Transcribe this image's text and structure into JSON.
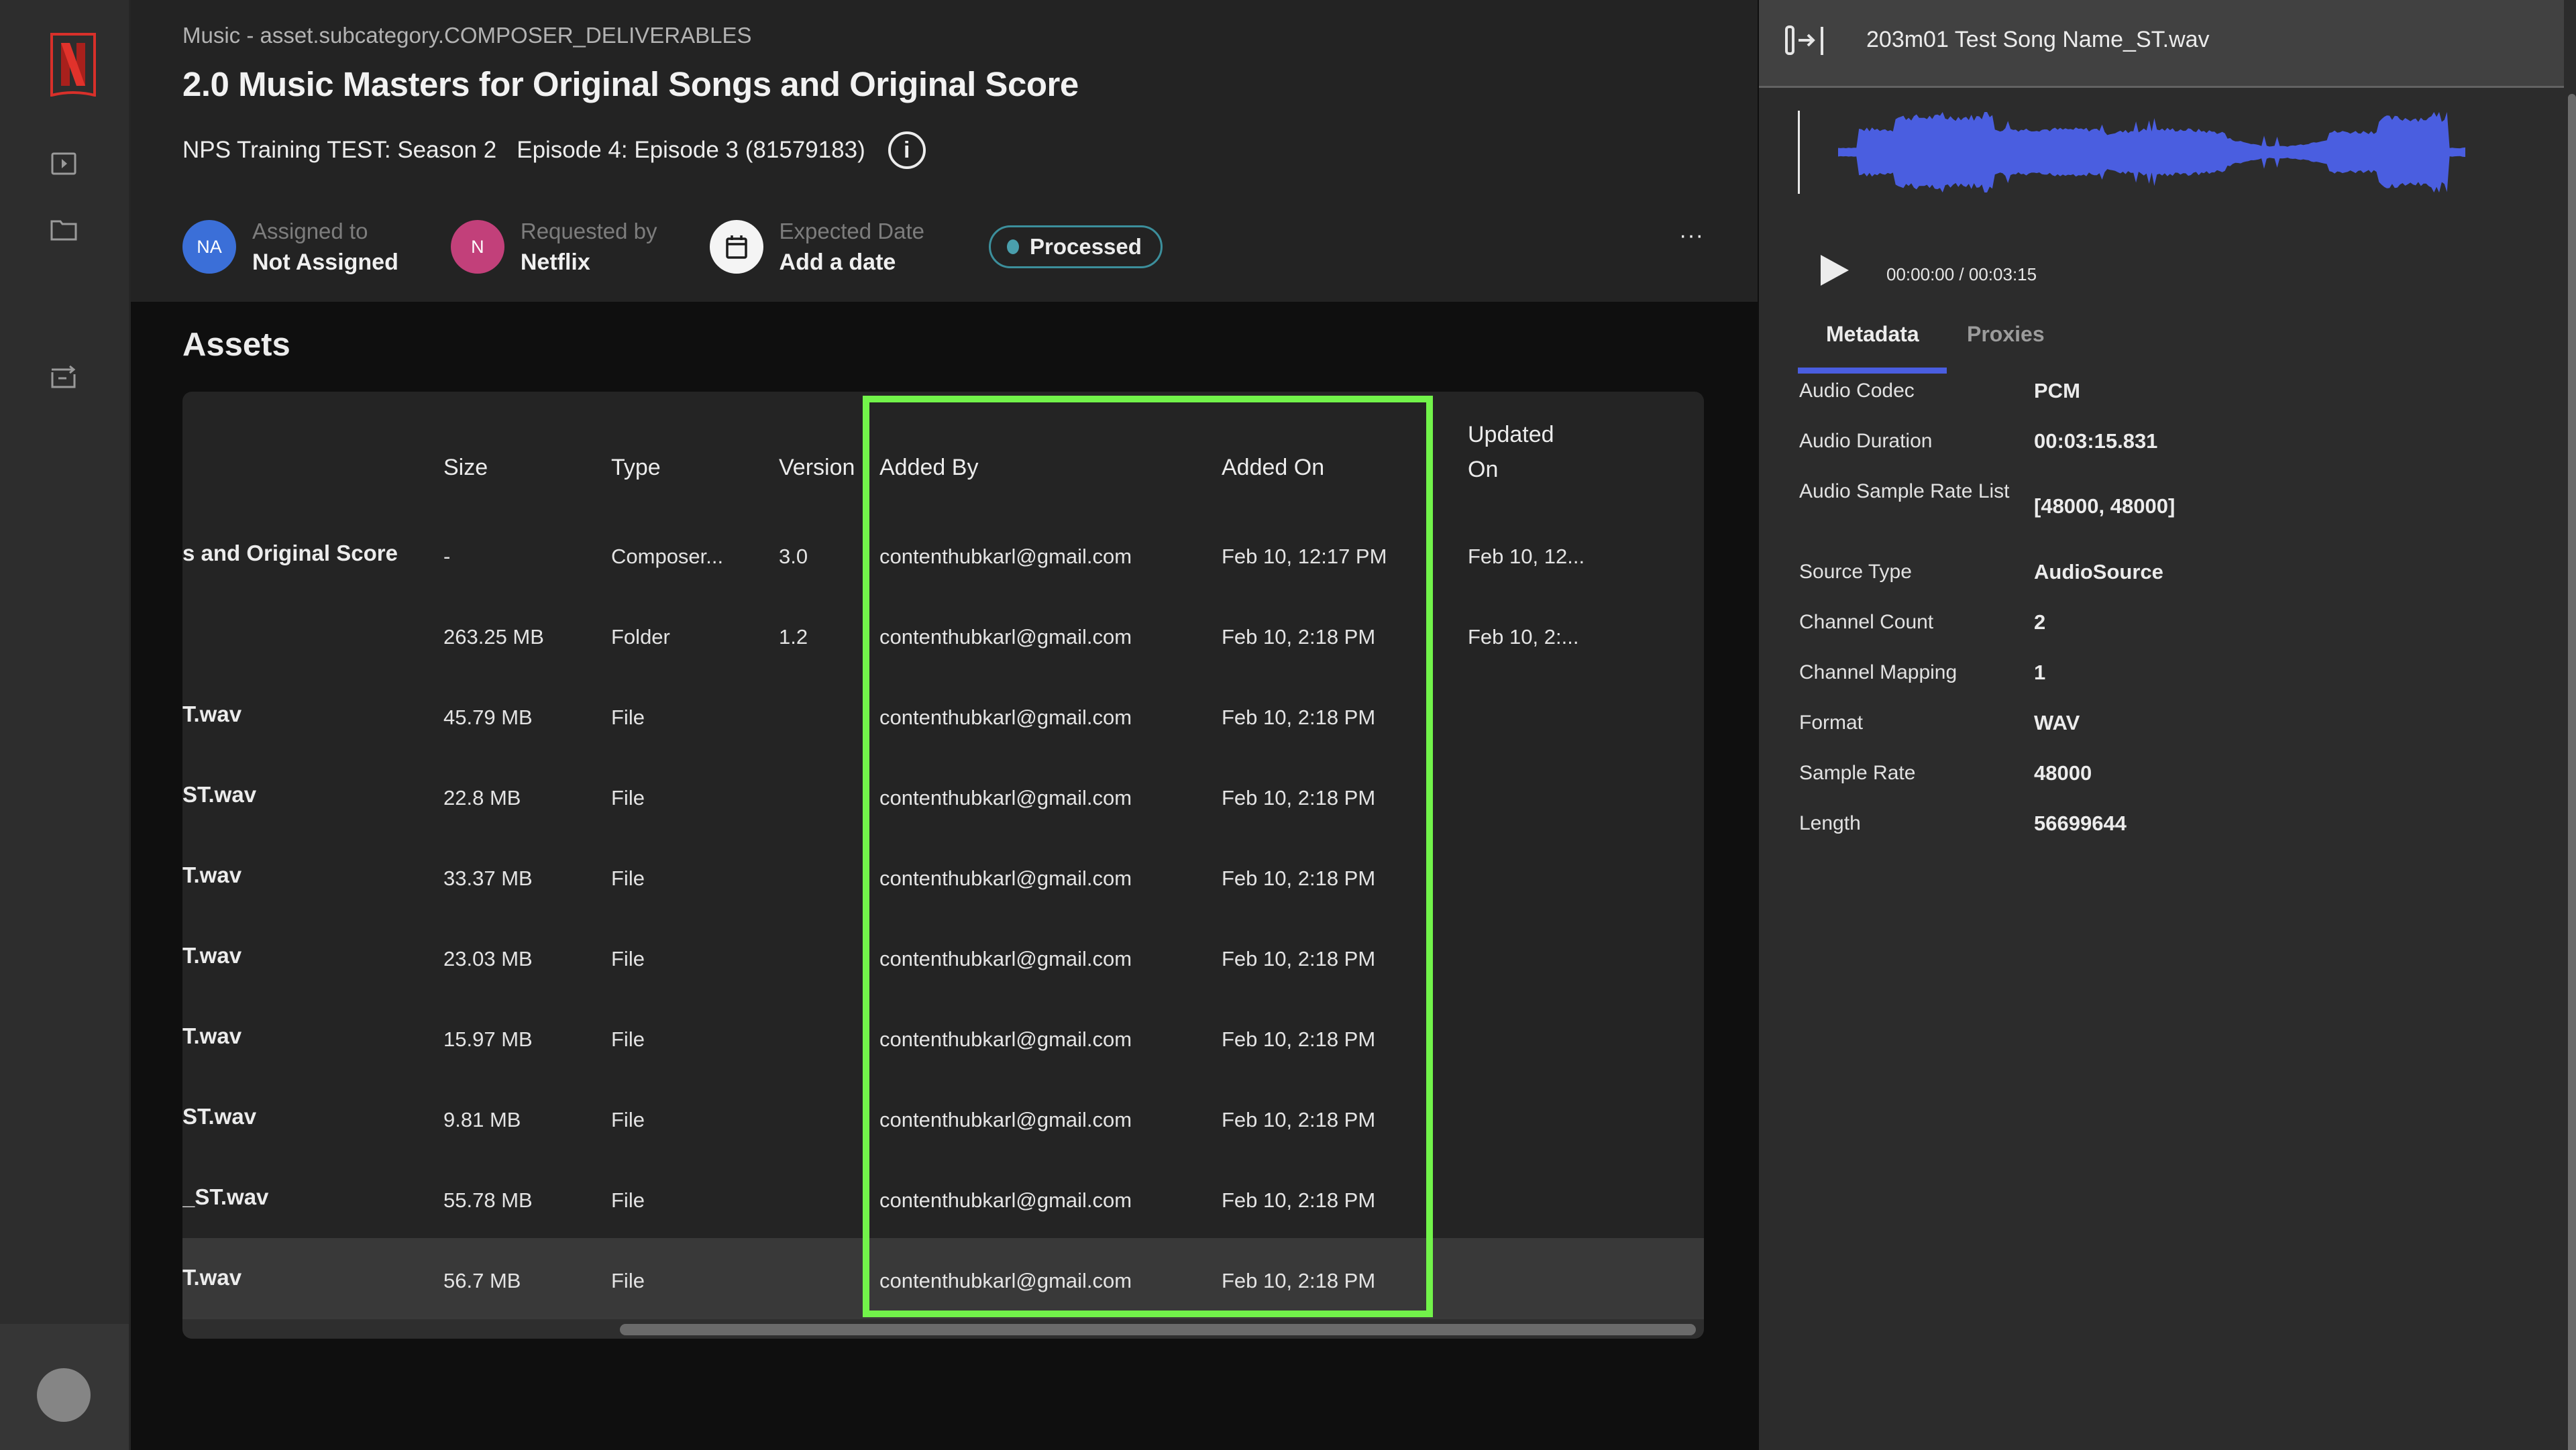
{
  "rail": {
    "logo": "netflix-logo",
    "nav": [
      {
        "name": "media-player",
        "icon": "play-square-icon"
      },
      {
        "name": "folder",
        "icon": "folder-icon"
      },
      {
        "name": "deliveries",
        "icon": "send-to-box-icon"
      }
    ]
  },
  "header": {
    "breadcrumb": "Music - asset.subcategory.COMPOSER_DELIVERABLES",
    "title": "2.0 Music Masters for Original Songs and Original Score",
    "show": "NPS Training TEST: Season 2",
    "episode": "Episode 4: Episode 3 (81579183)",
    "info_icon": "i",
    "assigned": {
      "label": "Assigned to",
      "value": "Not Assigned",
      "initials": "NA",
      "color": "#3b6fd8"
    },
    "requested": {
      "label": "Requested by",
      "value": "Netflix",
      "initials": "N",
      "color": "#c2407a"
    },
    "expected": {
      "label": "Expected Date",
      "value": "Add a date"
    },
    "status": {
      "label": "Processed",
      "color": "#4a9fad"
    },
    "more": "···"
  },
  "assets": {
    "title": "Assets",
    "columns": {
      "size": "Size",
      "type": "Type",
      "version": "Version",
      "added_by": "Added By",
      "added_on": "Added On",
      "updated_on_1": "Updated",
      "updated_on_2": "On"
    },
    "rows": [
      {
        "name": "s and Original Score",
        "size": "-",
        "type": "Composer...",
        "version": "3.0",
        "added_by": "contenthubkarl@gmail.com",
        "added_on": "Feb 10, 12:17 PM",
        "updated_on": "Feb 10, 12..."
      },
      {
        "name": "",
        "size": "263.25 MB",
        "type": "Folder",
        "version": "1.2",
        "added_by": "contenthubkarl@gmail.com",
        "added_on": "Feb 10, 2:18 PM",
        "updated_on": "Feb 10, 2:..."
      },
      {
        "name": "T.wav",
        "size": "45.79 MB",
        "type": "File",
        "version": "",
        "added_by": "contenthubkarl@gmail.com",
        "added_on": "Feb 10, 2:18 PM",
        "updated_on": ""
      },
      {
        "name": "ST.wav",
        "size": "22.8 MB",
        "type": "File",
        "version": "",
        "added_by": "contenthubkarl@gmail.com",
        "added_on": "Feb 10, 2:18 PM",
        "updated_on": ""
      },
      {
        "name": "T.wav",
        "size": "33.37 MB",
        "type": "File",
        "version": "",
        "added_by": "contenthubkarl@gmail.com",
        "added_on": "Feb 10, 2:18 PM",
        "updated_on": ""
      },
      {
        "name": "T.wav",
        "size": "23.03 MB",
        "type": "File",
        "version": "",
        "added_by": "contenthubkarl@gmail.com",
        "added_on": "Feb 10, 2:18 PM",
        "updated_on": ""
      },
      {
        "name": "T.wav",
        "size": "15.97 MB",
        "type": "File",
        "version": "",
        "added_by": "contenthubkarl@gmail.com",
        "added_on": "Feb 10, 2:18 PM",
        "updated_on": ""
      },
      {
        "name": "ST.wav",
        "size": "9.81 MB",
        "type": "File",
        "version": "",
        "added_by": "contenthubkarl@gmail.com",
        "added_on": "Feb 10, 2:18 PM",
        "updated_on": ""
      },
      {
        "name": "_ST.wav",
        "size": "55.78 MB",
        "type": "File",
        "version": "",
        "added_by": "contenthubkarl@gmail.com",
        "added_on": "Feb 10, 2:18 PM",
        "updated_on": ""
      },
      {
        "name": "T.wav",
        "size": "56.7 MB",
        "type": "File",
        "version": "",
        "added_by": "contenthubkarl@gmail.com",
        "added_on": "Feb 10, 2:18 PM",
        "updated_on": "",
        "selected": true
      }
    ],
    "highlight_color": "#72f34a"
  },
  "panel": {
    "title": "203m01 Test Song Name_ST.wav",
    "player": {
      "current": "00:00:00",
      "total": "00:03:15",
      "time_label": "00:00:00 / 00:03:15",
      "progress": 0
    },
    "waveform_color": "#4a5ee0",
    "tabs": [
      {
        "label": "Metadata",
        "active": true
      },
      {
        "label": "Proxies",
        "active": false
      }
    ],
    "metadata": [
      {
        "key": "Audio Codec",
        "value": "PCM"
      },
      {
        "key": "Audio Duration",
        "value": "00:03:15.831"
      },
      {
        "key": "Audio Sample Rate List",
        "value": "[48000, 48000]"
      },
      {
        "key": "Source Type",
        "value": "AudioSource"
      },
      {
        "key": "Channel Count",
        "value": "2"
      },
      {
        "key": "Channel Mapping",
        "value": "1"
      },
      {
        "key": "Format",
        "value": "WAV"
      },
      {
        "key": "Sample Rate",
        "value": "48000"
      },
      {
        "key": "Length",
        "value": "56699644"
      }
    ]
  }
}
